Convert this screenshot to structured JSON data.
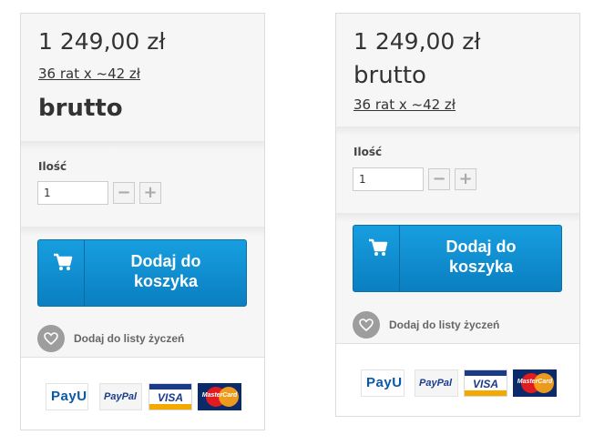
{
  "panels": [
    {
      "price": "1 249,00 zł",
      "installments": "36 rat x ~42 zł",
      "price_suffix": "brutto",
      "quantity_label": "Ilość",
      "quantity_value": "1",
      "decrement_symbol": "−",
      "increment_symbol": "+",
      "add_to_cart_line1": "Dodaj do",
      "add_to_cart_line2": "koszyka",
      "wishlist_label": "Dodaj do listy życzeń",
      "payment_logos": [
        "PayU",
        "PayPal",
        "VISA",
        "MasterCard"
      ]
    },
    {
      "price": "1 249,00 zł",
      "installments": "36 rat x ~42 zł",
      "price_suffix": "brutto",
      "quantity_label": "Ilość",
      "quantity_value": "1",
      "decrement_symbol": "−",
      "increment_symbol": "+",
      "add_to_cart_line1": "Dodaj do",
      "add_to_cart_line2": "koszyka",
      "wishlist_label": "Dodaj do listy życzeń",
      "payment_logos": [
        "PayU",
        "PayPal",
        "VISA",
        "MasterCard"
      ]
    }
  ],
  "icons": [
    "cart-icon",
    "heart-icon"
  ],
  "colors": {
    "button_blue": "#0a8fd6",
    "heart_gray": "#9d9d9d",
    "panel_bg": "#f6f6f6"
  }
}
